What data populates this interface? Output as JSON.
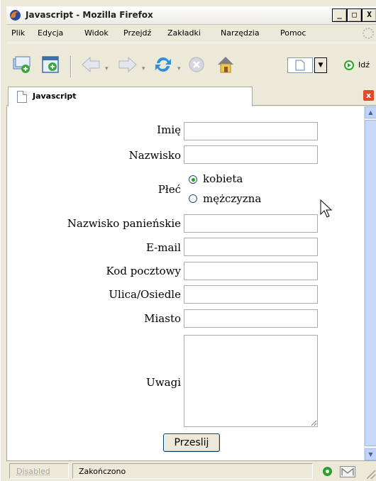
{
  "window": {
    "title": "Javascript - Mozilla Firefox",
    "buttons": {
      "minimize": "_",
      "maximize": "□",
      "close": "X"
    }
  },
  "menu": [
    {
      "label": "Plik"
    },
    {
      "label": "Edycja"
    },
    {
      "label": "Widok"
    },
    {
      "label": "Przejdź"
    },
    {
      "label": "Zakładki"
    },
    {
      "label": "Narzędzia"
    },
    {
      "label": "Pomoc"
    }
  ],
  "toolbar": {
    "go_label": "Idź",
    "icons": [
      "new-tab-icon",
      "new-window-icon",
      "back-icon",
      "forward-icon",
      "reload-icon",
      "stop-icon",
      "home-icon",
      "page-icon",
      "go-icon"
    ]
  },
  "tab": {
    "label": "Javascript",
    "close": "x"
  },
  "form": {
    "imie_label": "Imię",
    "nazwisko_label": "Nazwisko",
    "plec_label": "Płeć",
    "plec_options": [
      {
        "label": "kobieta",
        "checked": true
      },
      {
        "label": "mężczyzna",
        "checked": false
      }
    ],
    "nazwisko_panienskie_label": "Nazwisko panieńskie",
    "email_label": "E-mail",
    "kod_label": "Kod pocztowy",
    "ulica_label": "Ulica/Osiedle",
    "miasto_label": "Miasto",
    "uwagi_label": "Uwagi",
    "submit_label": "Przeslij"
  },
  "status": {
    "disabled_label": "Disabled",
    "text": "Zakończono"
  },
  "colors": {
    "go_green": "#2aa52a",
    "close_red": "#e04a2b",
    "window_bg": "#ece9d8"
  }
}
